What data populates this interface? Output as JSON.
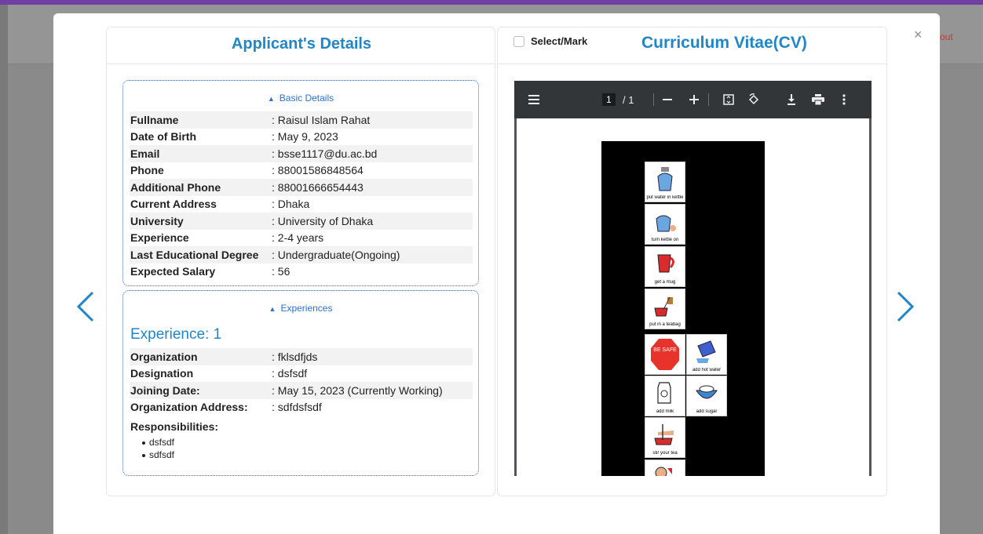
{
  "background": {
    "logout_text": "out"
  },
  "modal": {
    "close_glyph": "×",
    "prev_icon": "chevron-left-icon",
    "next_icon": "chevron-right-icon",
    "accent_color": "#1f86c8"
  },
  "left_panel": {
    "title": "Applicant's Details",
    "basic": {
      "toggle_label": "Basic Details",
      "rows": [
        {
          "label": "Fullname",
          "value": ": Raisul Islam Rahat"
        },
        {
          "label": "Date of Birth",
          "value": ": May 9, 2023"
        },
        {
          "label": "Email",
          "value": ": bsse1117@du.ac.bd"
        },
        {
          "label": "Phone",
          "value": ": 88001586848564"
        },
        {
          "label": "Additional Phone",
          "value": ": 88001666654443"
        },
        {
          "label": "Current Address",
          "value": ": Dhaka"
        },
        {
          "label": "University",
          "value": ": University of Dhaka"
        },
        {
          "label": "Experience",
          "value": ": 2-4 years"
        },
        {
          "label": "Last Educational Degree",
          "value": ": Undergraduate(Ongoing)"
        },
        {
          "label": "Expected Salary",
          "value": ": 56"
        }
      ]
    },
    "experiences": {
      "toggle_label": "Experiences",
      "heading": "Experience: 1",
      "rows": [
        {
          "label": "Organization",
          "value": ": fklsdfjds"
        },
        {
          "label": "Designation",
          "value": ": dsfsdf"
        },
        {
          "label": "Joining Date:",
          "value": ": May 15, 2023 (Currently Working)"
        },
        {
          "label": "Organization Address:",
          "value": ": sdfdsfsdf"
        }
      ],
      "responsibilities_label": "Responsibilities:",
      "responsibilities": [
        "dsfsdf",
        "sdfsdf"
      ]
    }
  },
  "right_panel": {
    "select_label": "Select/Mark",
    "title": "Curriculum Vitae(CV)",
    "pdf": {
      "current_page": "1",
      "total_pages": "/ 1",
      "tiles": [
        "put water in kettle",
        "turn kettle on",
        "get a mug",
        "put in a teabag",
        "BE SAFE",
        "add hot water",
        "add milk",
        "add sugar",
        "stir your tea"
      ]
    }
  }
}
